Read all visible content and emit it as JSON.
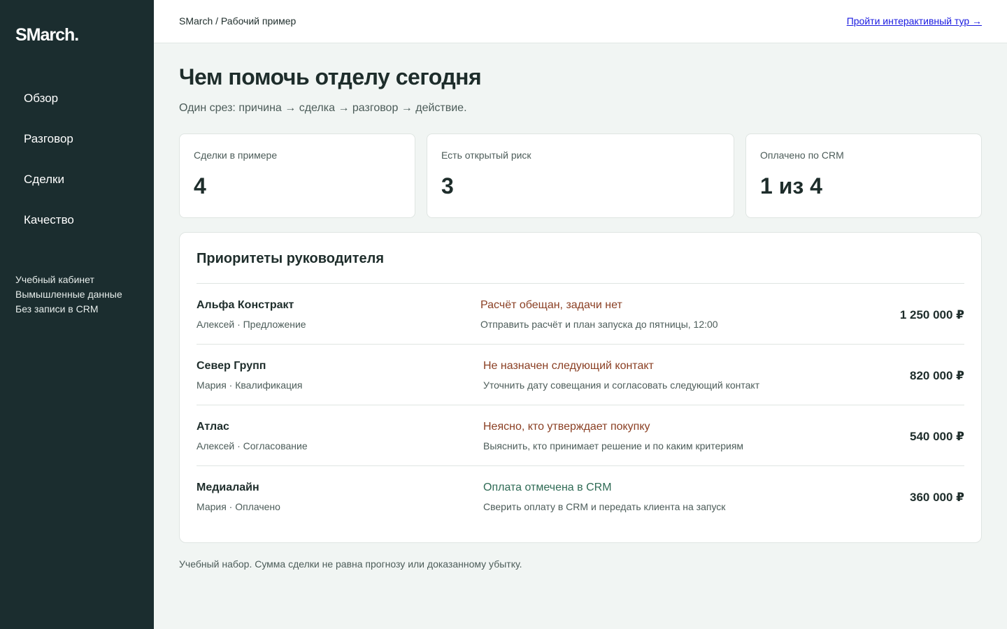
{
  "app": {
    "logo": "SMarch."
  },
  "sidebar": {
    "items": [
      {
        "label": "Обзор"
      },
      {
        "label": "Разговор"
      },
      {
        "label": "Сделки"
      },
      {
        "label": "Качество"
      }
    ],
    "notes": [
      "Учебный кабинет",
      "Вымышленные данные",
      "Без записи в CRM"
    ]
  },
  "header": {
    "breadcrumb": "SMarch / Рабочий пример",
    "tour_link": "Пройти интерактивный тур →"
  },
  "main": {
    "title": "Чем помочь отделу сегодня",
    "subtitle": "Один срез: причина → сделка → разговор → действие.",
    "stats": [
      {
        "label": "Сделки в примере",
        "value": "4"
      },
      {
        "label": "Есть открытый риск",
        "value": "3"
      },
      {
        "label": "Оплачено по CRM",
        "value": "1 из 4"
      }
    ],
    "priorities": {
      "title": "Приоритеты руководителя",
      "rows": [
        {
          "name": "Альфа Констракт",
          "meta": "Алексей · Предложение",
          "issue": "Расчёт обещан, задачи нет",
          "action": "Отправить расчёт и план запуска до пятницы, 12:00",
          "amount": "1 250 000 ₽"
        },
        {
          "name": "Север Групп",
          "meta": "Мария · Квалификация",
          "issue": "Не назначен следующий контакт",
          "action": "Уточнить дату совещания и согласовать следующий контакт",
          "amount": "820 000 ₽"
        },
        {
          "name": "Атлас",
          "meta": "Алексей · Согласование",
          "issue": "Неясно, кто утверждает покупку",
          "action": "Выяснить, кто принимает решение и по каким критериям",
          "amount": "540 000 ₽"
        },
        {
          "name": "Медиалайн",
          "meta": "Мария · Оплачено",
          "issue": "Оплата отмечена в CRM",
          "action": "Сверить оплату в CRM и передать клиента на запуск",
          "amount": "360 000 ₽"
        }
      ]
    },
    "footnote": "Учебный набор. Сумма сделки не равна прогнозу или доказанному убытку."
  },
  "colors": {
    "sidebar_bg": "#1b2d2f",
    "page_bg": "#f1f5f3",
    "risk_text": "#8a3f23",
    "ok_text": "#2f6b55",
    "link": "#1a1ae0"
  }
}
